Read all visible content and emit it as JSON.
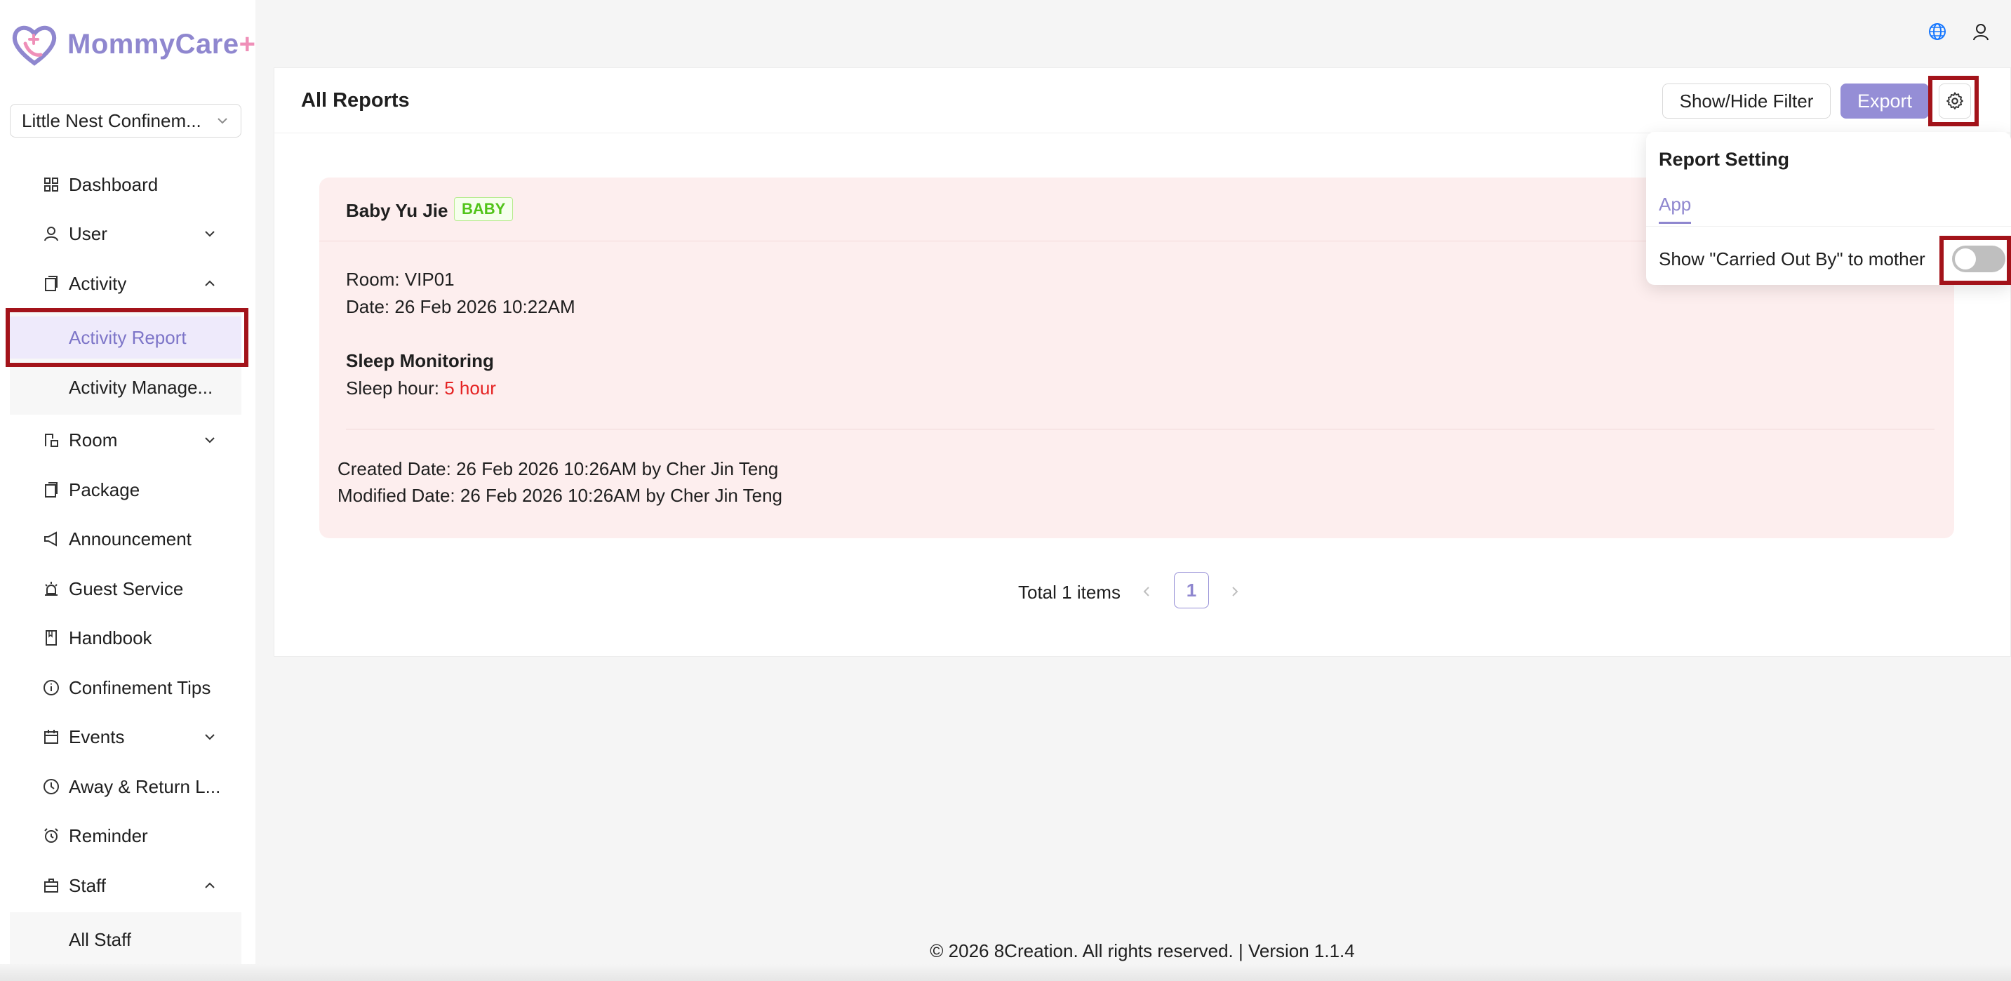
{
  "app": {
    "logo_text": "MommyCare",
    "logo_plus": "+"
  },
  "org_select": {
    "value": "Little Nest Confinem..."
  },
  "sidebar": {
    "items": [
      {
        "label": "Dashboard",
        "icon": "dashboard-icon"
      },
      {
        "label": "User",
        "icon": "user-icon"
      },
      {
        "label": "Activity",
        "icon": "clipboard-icon"
      },
      {
        "label": "Activity Report"
      },
      {
        "label": "Activity Manage..."
      },
      {
        "label": "Room",
        "icon": "room-icon"
      },
      {
        "label": "Package",
        "icon": "package-icon"
      },
      {
        "label": "Announcement",
        "icon": "megaphone-icon"
      },
      {
        "label": "Guest Service",
        "icon": "bell-icon"
      },
      {
        "label": "Handbook",
        "icon": "book-icon"
      },
      {
        "label": "Confinement Tips",
        "icon": "info-icon"
      },
      {
        "label": "Events",
        "icon": "calendar-icon"
      },
      {
        "label": "Away & Return L...",
        "icon": "clock-icon"
      },
      {
        "label": "Reminder",
        "icon": "alarm-icon"
      },
      {
        "label": "Staff",
        "icon": "staff-icon"
      },
      {
        "label": "All Staff"
      }
    ]
  },
  "header": {
    "globe_icon": "globe-icon",
    "profile_icon": "user-icon"
  },
  "main": {
    "title": "All Reports",
    "filter_button": "Show/Hide Filter",
    "export_button": "Export",
    "settings_icon": "gear-icon"
  },
  "report": {
    "name": "Baby Yu Jie",
    "badge": "BABY",
    "room": "Room: VIP01",
    "date": "Date: 26 Feb 2026 10:22AM",
    "section": "Sleep Monitoring",
    "sleep_label": "Sleep hour:",
    "sleep_value": "5 hour",
    "created": "Created Date: 26 Feb 2026 10:26AM by Cher Jin Teng",
    "modified": "Modified Date: 26 Feb 2026 10:26AM by Cher Jin Teng"
  },
  "pagination": {
    "total": "Total 1 items",
    "current": "1"
  },
  "popover": {
    "title": "Report Setting",
    "tab": "App",
    "label": "Show \"Carried Out By\" to mother",
    "toggle_on": false
  },
  "footer": {
    "text": "© 2026 8Creation. All rights reserved. | Version 1.1.4"
  },
  "colors": {
    "accent": "#958ed6",
    "highlight": "#a3131a",
    "report_bg": "#fdeeee",
    "badge": "#52c41a",
    "danger": "#e52222"
  }
}
